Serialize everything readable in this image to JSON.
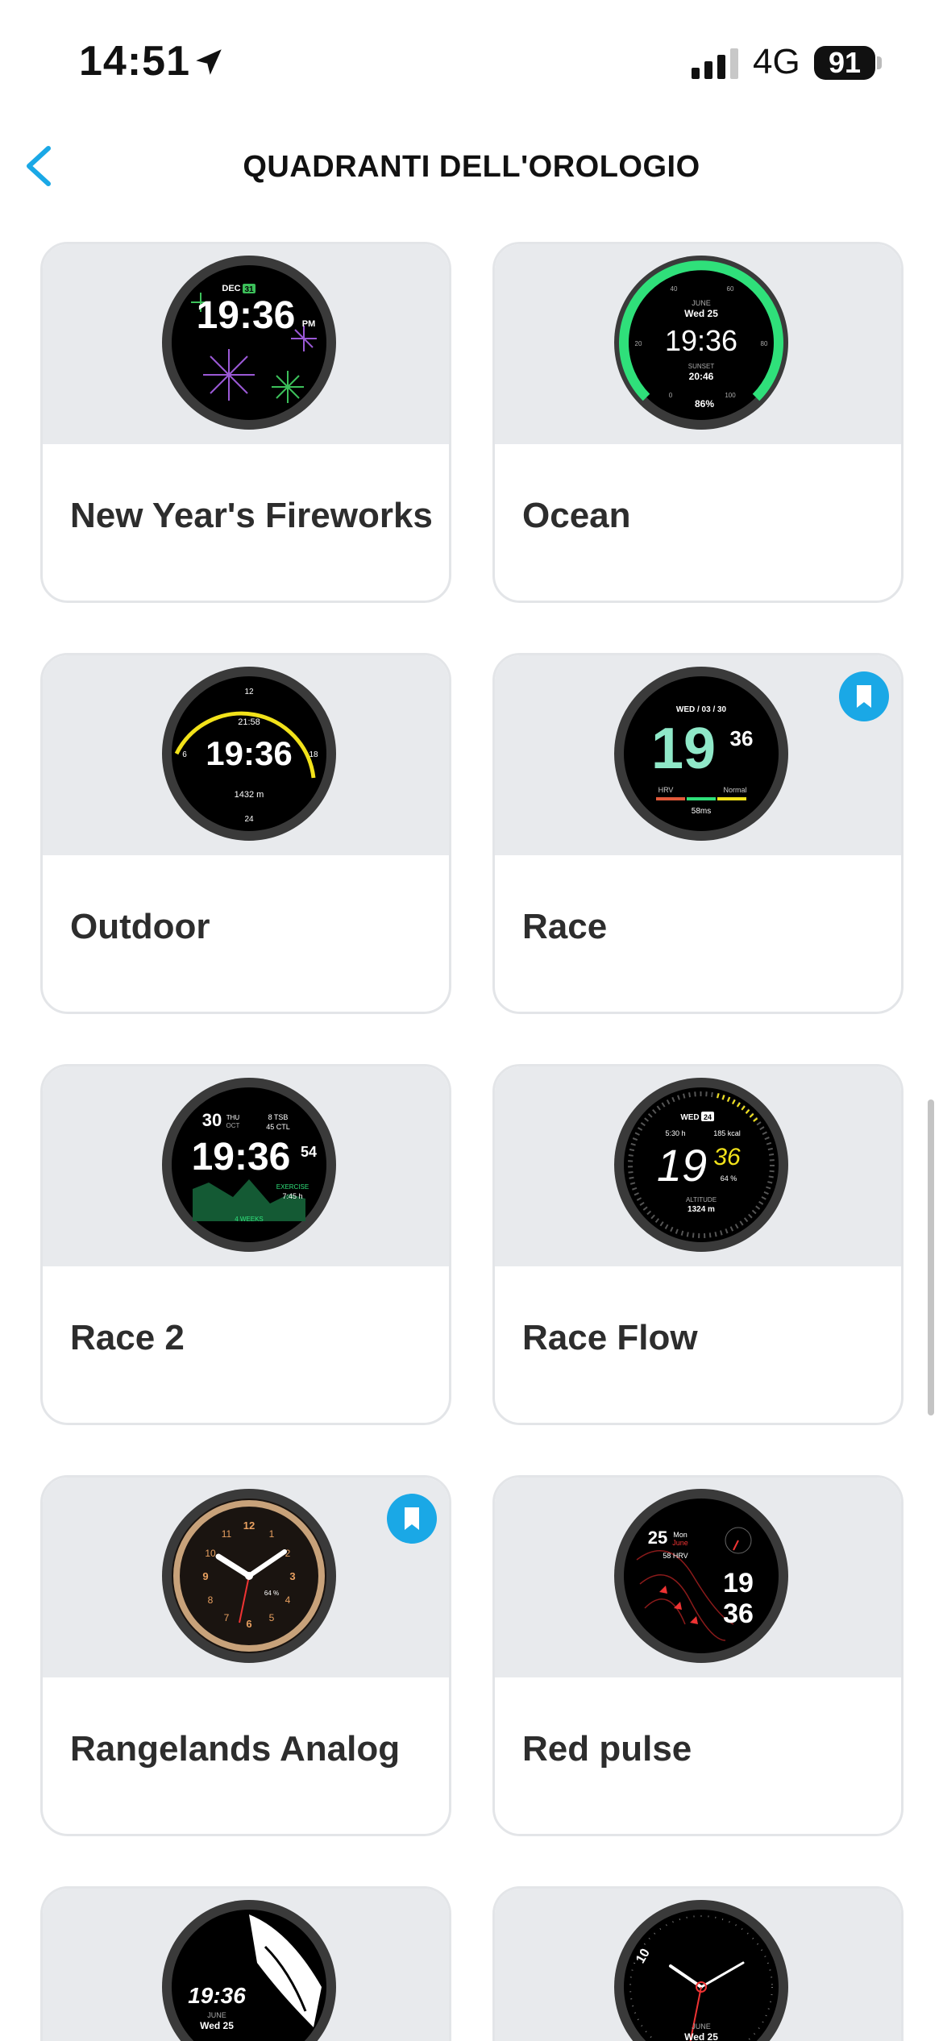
{
  "status": {
    "time": "14:51",
    "network": "4G",
    "battery": "91"
  },
  "header": {
    "title": "QUADRANTI DELL'OROLOGIO"
  },
  "faces": [
    {
      "name": "New Year's Fireworks",
      "date": "DEC",
      "day": "31",
      "time": "19:36",
      "ampm": "PM"
    },
    {
      "name": "Ocean",
      "month": "JUNE",
      "date": "Wed 25",
      "time": "19:36",
      "sunset_label": "SUNSET",
      "sunset": "20:46",
      "battery": "86%",
      "scale": [
        "40",
        "60",
        "20",
        "80",
        "0",
        "100"
      ]
    },
    {
      "name": "Outdoor",
      "sunrise": "21:58",
      "time": "19:36",
      "altitude": "1432 m",
      "ticks": [
        "12",
        "6",
        "18",
        "24"
      ]
    },
    {
      "name": "Race",
      "date": "WED / 03 / 30",
      "hour": "19",
      "minute": "36",
      "hrv_label": "HRV",
      "status": "Normal",
      "hrv": "58ms",
      "bookmarked": true
    },
    {
      "name": "Race 2",
      "day": "30",
      "weekday": "THU",
      "month": "OCT",
      "tsb": "8 TSB",
      "ctl": "45 CTL",
      "time": "19:36",
      "seconds": "54",
      "exercise_label": "EXERCISE",
      "exercise": "7:45 h",
      "weeks": "4 WEEKS"
    },
    {
      "name": "Race Flow",
      "weekday": "WED",
      "day": "24",
      "duration": "5:30 h",
      "kcal": "185 kcal",
      "battery": "64 %",
      "hour": "19",
      "minute": "36",
      "altitude_label": "ALTITUDE",
      "altitude": "1324 m"
    },
    {
      "name": "Rangelands Analog",
      "battery": "64 %",
      "numbers": [
        "12",
        "3",
        "6",
        "9",
        "1",
        "2",
        "4",
        "5",
        "7",
        "8",
        "10",
        "11"
      ],
      "bookmarked": true
    },
    {
      "name": "Red pulse",
      "day": "25",
      "weekday": "Mon",
      "month": "June",
      "hrv": "58 HRV",
      "hour": "19",
      "minute": "36"
    },
    {
      "name": "",
      "time": "19:36",
      "month": "JUNE",
      "date": "Wed 25"
    },
    {
      "name": "",
      "number": "10",
      "month": "JUNE",
      "date": "Wed 25"
    }
  ]
}
